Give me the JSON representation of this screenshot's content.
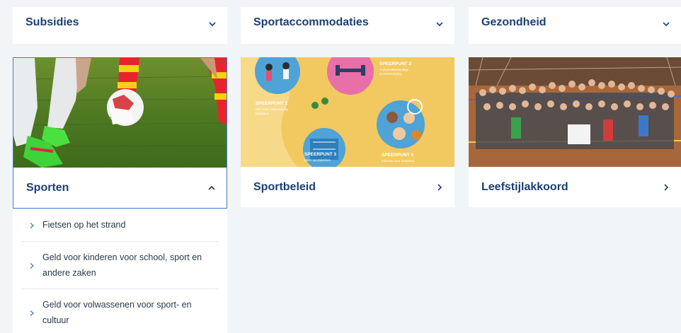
{
  "top_cards": [
    {
      "title": "Subsidies"
    },
    {
      "title": "Sportaccommodaties"
    },
    {
      "title": "Gezondheid"
    }
  ],
  "image_cards": [
    {
      "title": "Sporten",
      "image": "soccer-players-photo",
      "expanded": true
    },
    {
      "title": "Sportbeleid",
      "image": "sport-policy-illustration",
      "illustration": {
        "speerpunt1": {
          "label": "SPEERPUNT 1",
          "caption": "Een leven lang vaardig bewegen"
        },
        "speerpunt2": {
          "label": "SPEERPUNT 2",
          "caption": "Toekomstbestendige sportvereniging"
        },
        "speerpunt3": {
          "label": "SPEERPUNT 3",
          "caption": "Meer sportplekken"
        },
        "speerpunt4": {
          "label": "SPEERPUNT 4",
          "caption": "Iedereen kan meedoen"
        }
      }
    },
    {
      "title": "Leefstijlakkoord",
      "image": "group-photo-in-gym"
    }
  ],
  "sporten_links": [
    {
      "label": "Fietsen op het strand"
    },
    {
      "label": "Geld voor kinderen voor school, sport en andere zaken"
    },
    {
      "label": "Geld voor volwassenen voor sport- en cultuur"
    }
  ],
  "colors": {
    "title": "#1c3f73",
    "active_border": "#3f7fc4",
    "background": "#f1f5f8",
    "illustration_bg": "#f2c960"
  }
}
